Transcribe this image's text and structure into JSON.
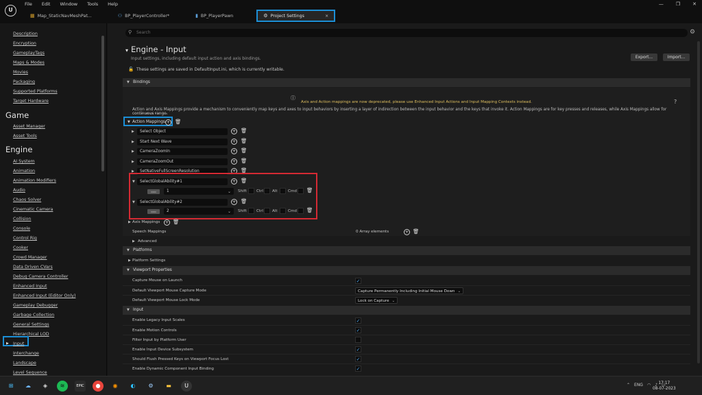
{
  "menu": [
    "File",
    "Edit",
    "Window",
    "Tools",
    "Help"
  ],
  "tabs": [
    {
      "label": "Map_StaticNavMeshPat..."
    },
    {
      "label": "BP_PlayerController*"
    },
    {
      "label": "BP_PlayerPawn"
    },
    {
      "label": "Project Settings"
    }
  ],
  "sidebar": {
    "items_top": [
      "Description",
      "Encryption",
      "GameplayTags",
      "Maps & Modes",
      "Movies",
      "Packaging",
      "Supported Platforms",
      "Target Hardware"
    ],
    "game_header": "Game",
    "game_items": [
      "Asset Manager",
      "Asset Tools"
    ],
    "engine_header": "Engine",
    "engine_items": [
      "AI System",
      "Animation",
      "Animation Modifiers",
      "Audio",
      "Chaos Solver",
      "Cinematic Camera",
      "Collision",
      "Console",
      "Control Rig",
      "Cooker",
      "Crowd Manager",
      "Data Driven CVars",
      "Debug Camera Controller",
      "Enhanced Input",
      "Enhanced Input (Editor Only)",
      "Gameplay Debugger",
      "Garbage Collection",
      "General Settings",
      "Hierarchical LOD",
      "Input",
      "Interchange",
      "Landscape",
      "Level Sequence"
    ]
  },
  "search": {
    "placeholder": "Search"
  },
  "page": {
    "title": "Engine - Input",
    "subtitle": "Input settings, including default input action and axis bindings.",
    "export_label": "Export...",
    "import_label": "Import...",
    "save_note": "These settings are saved in DefaultInput.ini, which is currently writable."
  },
  "bindings": {
    "header": "Bindings",
    "warning": "Axis and Action mappings are now deprecated, please use Enhanced Input Actions and Input Mapping Contexts instead.",
    "desc_line1": "Action and Axis Mappings provide a mechanism to conveniently map keys and axes to input behaviors by inserting a layer of indirection between the input behavior and the keys that invoke it. Action Mappings are for key presses and releases, while Axis Mappings allow for inputs that have a",
    "desc_line2": "continuous range.",
    "action_mappings_label": "Action Mappings",
    "actions": [
      "Select Object",
      "Start Next Wave",
      "CameraZoomIn",
      "CameraZoomOut",
      "SetNativeFullScreenResolution"
    ],
    "expanded": [
      {
        "name": "SelectGlobalAbility#1",
        "key": "1"
      },
      {
        "name": "SelectGlobalAbility#2",
        "key": "2"
      }
    ],
    "keyboard_icon": "keyboard-icon",
    "modifiers": [
      "Shift",
      "Ctrl",
      "Alt",
      "Cmd"
    ],
    "axis_mappings_label": "Axis Mappings",
    "speech_label": "Speech Mappings",
    "speech_value": "0 Array elements",
    "advanced_label": "Advanced"
  },
  "platforms": {
    "header": "Platforms",
    "item": "Platform Settings"
  },
  "viewport": {
    "header": "Viewport Properties",
    "capture_on_launch": "Capture Mouse on Launch",
    "capture_mode_label": "Default Viewport Mouse Capture Mode",
    "capture_mode_value": "Capture Permanently Including Initial Mouse Down",
    "lock_mode_label": "Default Viewport Mouse Lock Mode",
    "lock_mode_value": "Lock on Capture"
  },
  "input": {
    "header": "Input",
    "rows": [
      {
        "label": "Enable Legacy Input Scales",
        "checked": true
      },
      {
        "label": "Enable Motion Controls",
        "checked": true
      },
      {
        "label": "Filter Input by Platform User",
        "checked": false
      },
      {
        "label": "Enable Input Device Subsystem",
        "checked": true
      },
      {
        "label": "Should Flush Pressed Keys on Viewport Focus Lost",
        "checked": true
      },
      {
        "label": "Enable Dynamic Component Input Binding",
        "checked": true
      }
    ]
  },
  "taskbar": {
    "lang": "ENG",
    "time": "17:17",
    "date": "08-07-2023"
  },
  "colors": {
    "highlight": "#1c8fd6",
    "red_box": "#d62a33",
    "warning": "#e0c060",
    "checkmark": "#4aa3ea"
  }
}
